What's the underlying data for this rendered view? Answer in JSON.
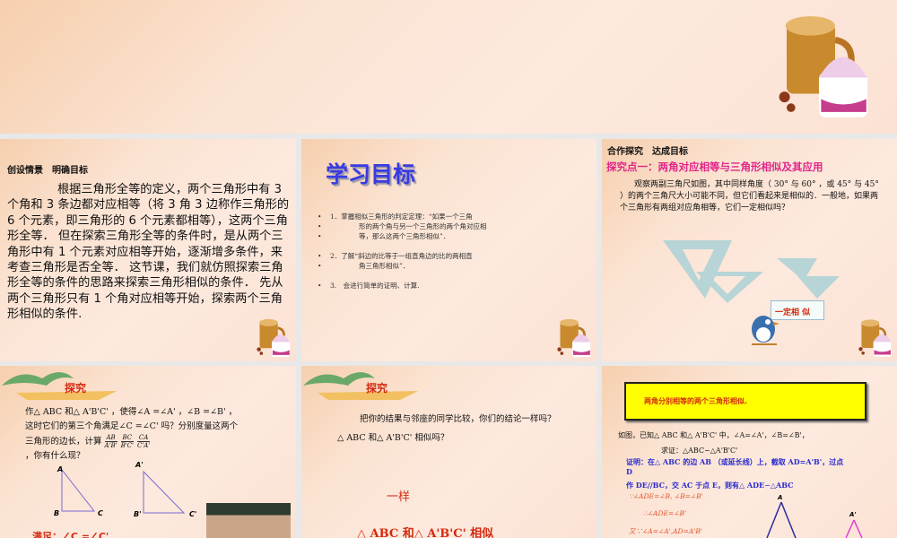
{
  "slide1": {
    "heading": "创设情景　明确目标",
    "body": "根据三角形全等的定义，两个三角形中有 3 个角和 3 条边都对应相等（将 3 角 3 边称作三角形的 6 个元素，即三角形的 6 个元素都相等），这两个三角形全等． 但在探索三角形全等的条件时，是从两个三角形中有 1 个元素对应相等开始，逐渐增多条件，来考查三角形是否全等． 这节课，我们就仿照探索三角形全等的条件的思路来探索三角形相似的条件． 先从两个三角形只有 1 个角对应相等开始，探索两个三角形相似的条件."
  },
  "slide2": {
    "title": "学习目标",
    "items": [
      "1．掌握相似三角形的判定定理：“如果一个三角",
      "形的两个角与另一个三角形的两个角对应相",
      "等，那么这两个三角形相似”．",
      "2．了解“斜边的比等于一组直角边的比的两相直",
      "角三角形相似”．",
      "3.　会进行简单的证明、计算."
    ]
  },
  "slide3": {
    "heading": "合作探究　达成目标",
    "subtitle": "探究点一：两角对应相等与三角形相似及其应用",
    "body": "观察两副三角尺如图，其中同样角度（ 30° 与 60° ，或 45° 与 45° ）的两个三角尺大小可能不同，但它们看起来是相似的．一般地，如果两个三角形有两组对应角相等，它们一定相似吗？",
    "flag": "一定相 似"
  },
  "slide4": {
    "badge": "探究",
    "line1": "作△ ABC 和△ A'B'C' ，使得∠A =∠A' ，∠B =∠B' ，",
    "line2": "这时它们的第三个角满足∠C =∠C' 吗？分别度量这两个",
    "line3": "三角形的边长，计算",
    "frac": [
      [
        "AB",
        "A'B'"
      ],
      [
        "BC",
        "B'C'"
      ],
      [
        "CA",
        "C'A'"
      ]
    ],
    "line4": "，你有什么现？",
    "labels": [
      "A",
      "B",
      "C",
      "A'",
      "B'",
      "C'"
    ],
    "answer": "满足：∠C =∠C'"
  },
  "slide5": {
    "badge": "探究",
    "line1": "把你的结果与邻座的同学比较，你们的结论一样吗？",
    "line2": "△ ABC 和△ A'B'C' 相似吗？",
    "ans1": "一样",
    "ans2": "△ ABC 和△ A'B'C' 相似"
  },
  "slide6": {
    "theorem": "两角分别相等的两个三角形相似.",
    "given": "如图，已知△ ABC 和△ A'B'C' 中，∠A=∠A'，∠B=∠B'，",
    "prove": "求证：△ABC∽△A'B'C'",
    "proof1": "证明：在△ ABC 的边 AB （或延长线）上，截取 AD=A'B'，过点",
    "proof2": "D",
    "proof3": "作 DE//BC，交 AC 于点 E，则有△ ADE∽△ABC",
    "s1": "∵∠ADE=∠B, ∠B=∠B'",
    "s2": "∴∠ADE=∠B'",
    "s3": "又∵∠A=∠A',AD=A'B'",
    "labels": [
      "A",
      "A'"
    ]
  },
  "colors": {
    "red": "#d42a10",
    "blue": "#2a2ad0",
    "yellow": "#ffff00",
    "magenta": "#e03ad8"
  }
}
